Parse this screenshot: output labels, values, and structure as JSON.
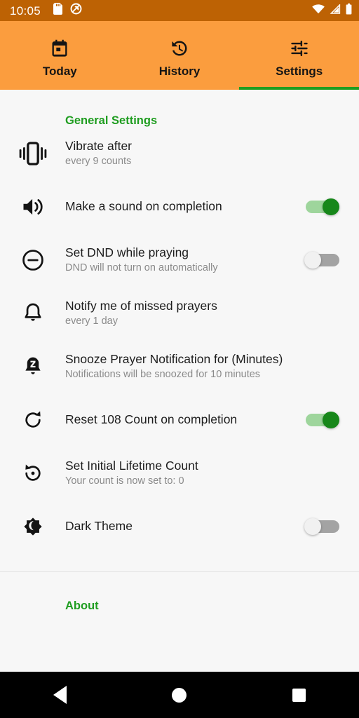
{
  "status_bar": {
    "time": "10:05",
    "left_icons": [
      "sd-card-icon",
      "dnd-off-icon"
    ],
    "right_icons": [
      "wifi-icon",
      "cellular-signal-icon",
      "battery-icon"
    ],
    "background_color": "#bd6204",
    "foreground_color": "#ffffff"
  },
  "tabs": {
    "background_color": "#fb9d3e",
    "indicator_color": "#1f9d20",
    "items": [
      {
        "label": "Today",
        "icon": "calendar-icon",
        "active": false
      },
      {
        "label": "History",
        "icon": "history-clock-icon",
        "active": false
      },
      {
        "label": "Settings",
        "icon": "tune-sliders-icon",
        "active": true
      }
    ]
  },
  "sections": {
    "general": {
      "header": "General Settings",
      "accent_color": "#1f9d20"
    },
    "about": {
      "header": "About",
      "accent_color": "#1f9d20"
    }
  },
  "rows": [
    {
      "icon": "vibration-icon",
      "title": "Vibrate after",
      "subtitle": "every 9 counts",
      "control": "none"
    },
    {
      "icon": "volume-up-icon",
      "title": "Make a sound on completion",
      "subtitle": "",
      "control": "toggle",
      "toggle_on": true
    },
    {
      "icon": "do-not-disturb-icon",
      "title": "Set DND while praying",
      "subtitle": "DND will not turn on automatically",
      "control": "toggle",
      "toggle_on": false
    },
    {
      "icon": "bell-icon",
      "title": "Notify me of missed prayers",
      "subtitle": "every 1 day",
      "control": "none"
    },
    {
      "icon": "notification-snooze-icon",
      "title": "Snooze Prayer Notification for (Minutes)",
      "subtitle": "Notifications will be snoozed for 10 minutes",
      "control": "none"
    },
    {
      "icon": "refresh-icon",
      "title": "Reset 108 Count on completion",
      "subtitle": "",
      "control": "toggle",
      "toggle_on": true
    },
    {
      "icon": "restore-history-icon",
      "title": "Set Initial Lifetime Count",
      "subtitle": "Your count is now set to: 0",
      "control": "none"
    },
    {
      "icon": "brightness-dark-icon",
      "title": "Dark Theme",
      "subtitle": "",
      "control": "toggle",
      "toggle_on": false
    }
  ],
  "nav_bar": {
    "background_color": "#000000",
    "buttons": [
      {
        "name": "back",
        "icon": "back-triangle-icon"
      },
      {
        "name": "home",
        "icon": "home-circle-icon"
      },
      {
        "name": "recents",
        "icon": "recents-square-icon"
      }
    ]
  }
}
